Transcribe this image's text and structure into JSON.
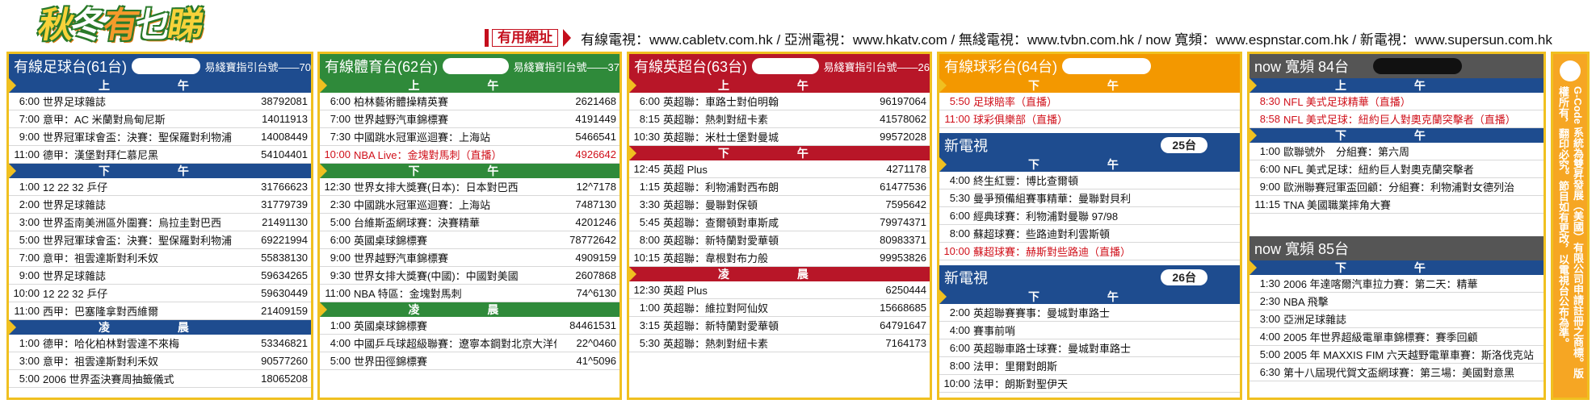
{
  "logo_text": [
    "秋",
    "冬",
    "有",
    "乜",
    "睇"
  ],
  "links": {
    "label": "有用網址",
    "text": "有線電視：www.cabletv.com.hk / 亞洲電視：www.hkatv.com / 無綫電視：www.tvbn.com.hk / now 寬頻：www.espnstar.com.hk / 新電視：www.supersun.com.hk"
  },
  "sections": {
    "am": "上 午",
    "pm": "下 午",
    "night": "凌 晨"
  },
  "panel1": {
    "title": "有線足球台(61台)",
    "guide": "易綫寶指引台號——70",
    "am": [
      {
        "t": "6:00",
        "p": "世界足球雜誌",
        "c": "38792081"
      },
      {
        "t": "7:00",
        "p": "意甲：AC 米蘭對烏甸尼斯",
        "c": "14011913"
      },
      {
        "t": "9:00",
        "p": "世界冠軍球會盃：決賽：聖保羅對利物浦",
        "c": "14008449"
      },
      {
        "t": "11:00",
        "p": "德甲：漢堡對拜仁慕尼黑",
        "c": "54104401"
      }
    ],
    "pm": [
      {
        "t": "1:00",
        "p": "12 22 32 乒仔",
        "c": "31766623"
      },
      {
        "t": "2:00",
        "p": "世界足球雜誌",
        "c": "31779739"
      },
      {
        "t": "3:00",
        "p": "世界盃南美洲區外圍賽：烏拉圭對巴西",
        "c": "21491130"
      },
      {
        "t": "5:00",
        "p": "世界冠軍球會盃：決賽：聖保羅對利物浦",
        "c": "69221994"
      },
      {
        "t": "7:00",
        "p": "意甲：祖雲達斯對利禾奴",
        "c": "55838130"
      },
      {
        "t": "9:00",
        "p": "世界足球雜誌",
        "c": "59634265"
      },
      {
        "t": "10:00",
        "p": "12 22 32 乒仔",
        "c": "59630449"
      },
      {
        "t": "11:00",
        "p": "西甲：巴塞隆拿對西維爾",
        "c": "21409159"
      }
    ],
    "night": [
      {
        "t": "1:00",
        "p": "德甲：哈化柏林對雲達不來梅",
        "c": "53346821"
      },
      {
        "t": "3:00",
        "p": "意甲：祖雲達斯對利禾奴",
        "c": "90577260"
      },
      {
        "t": "5:00",
        "p": "2006 世界盃決賽周抽籤儀式",
        "c": "18065208"
      }
    ]
  },
  "panel2": {
    "title": "有線體育台(62台)",
    "guide": "易綫寶指引台號——37",
    "am": [
      {
        "t": "6:00",
        "p": "柏林藝術體操精英賽",
        "c": "2621468"
      },
      {
        "t": "7:00",
        "p": "世界越野汽車錦標賽",
        "c": "4191449"
      },
      {
        "t": "7:30",
        "p": "中國跳水冠軍巡迴賽：上海站",
        "c": "5466541"
      },
      {
        "t": "10:00",
        "p": "NBA Live：金塊對馬刺（直播）",
        "c": "4926642",
        "live": true
      }
    ],
    "pm": [
      {
        "t": "12:30",
        "p": "世界女排大獎賽(日本)：日本對巴西",
        "c": "12^7178"
      },
      {
        "t": "2:30",
        "p": "中國跳水冠軍巡迴賽：上海站",
        "c": "7487130"
      },
      {
        "t": "5:00",
        "p": "台維斯盃網球賽：決賽精華",
        "c": "4201246"
      },
      {
        "t": "6:00",
        "p": "英國桌球錦標賽",
        "c": "78772642"
      },
      {
        "t": "9:00",
        "p": "世界越野汽車錦標賽",
        "c": "4909159"
      },
      {
        "t": "9:30",
        "p": "世界女排大獎賽(中國)：中國對美國",
        "c": "2607868"
      },
      {
        "t": "11:00",
        "p": "NBA 特區：金塊對馬刺",
        "c": "74^6130"
      }
    ],
    "night": [
      {
        "t": "1:00",
        "p": "英國桌球錦標賽",
        "c": "84461531"
      },
      {
        "t": "4:00",
        "p": "中國乒乓球超級聯賽：遼寧本鋼對北京大洋伐克",
        "c": "22^0460"
      },
      {
        "t": "5:00",
        "p": "世界田徑錦標賽",
        "c": "41^5096"
      }
    ]
  },
  "panel3": {
    "title": "有線英超台(63台)",
    "guide": "易綫寶指引台號——26",
    "am": [
      {
        "t": "6:00",
        "p": "英超聯：車路士對伯明翰",
        "c": "96197064"
      },
      {
        "t": "8:15",
        "p": "英超聯：熱刺對紐卡素",
        "c": "41578062"
      },
      {
        "t": "10:30",
        "p": "英超聯：米杜士堡對曼城",
        "c": "99572028"
      }
    ],
    "pm": [
      {
        "t": "12:45",
        "p": "英超 Plus",
        "c": "4271178"
      },
      {
        "t": "1:15",
        "p": "英超聯：利物浦對西布朗",
        "c": "61477536"
      },
      {
        "t": "3:30",
        "p": "英超聯：曼聯對保頓",
        "c": "7595642"
      },
      {
        "t": "5:45",
        "p": "英超聯：查爾頓對車斯咸",
        "c": "79974371"
      },
      {
        "t": "8:00",
        "p": "英超聯：新特蘭對愛華頓",
        "c": "80983371"
      },
      {
        "t": "10:15",
        "p": "英超聯：韋根對布力般",
        "c": "99953826"
      }
    ],
    "night": [
      {
        "t": "12:30",
        "p": "英超 Plus",
        "c": "6250444"
      },
      {
        "t": "1:00",
        "p": "英超聯：維拉對阿仙奴",
        "c": "15668685"
      },
      {
        "t": "3:15",
        "p": "英超聯：新特蘭對愛華頓",
        "c": "64791647"
      },
      {
        "t": "5:30",
        "p": "英超聯：熱刺對紐卡素",
        "c": "7164173"
      }
    ]
  },
  "panel4": {
    "title": "有線球彩台(64台)",
    "pm": [
      {
        "t": "5:50",
        "p": "足球賠率（直播）",
        "live": true
      },
      {
        "t": "11:00",
        "p": "球彩俱樂部（直播）",
        "live": true
      }
    ],
    "new25": {
      "title": "新電視",
      "badge": "25台",
      "rows": [
        {
          "t": "4:00",
          "p": "終生紅豐：博比查爾頓"
        },
        {
          "t": "5:30",
          "p": "曼爭預備組賽事精華：曼聯對貝利"
        },
        {
          "t": "6:00",
          "p": "經典球賽：利物浦對曼聯 97/98"
        },
        {
          "t": "8:00",
          "p": "蘇超球賽：些路迪對利雲斯頓"
        },
        {
          "t": "10:00",
          "p": "蘇超球賽：赫斯對些路迪（直播）",
          "live": true
        }
      ]
    },
    "new26": {
      "title": "新電視",
      "badge": "26台",
      "rows": [
        {
          "t": "2:00",
          "p": "英超聯賽賽事：曼城對車路士"
        },
        {
          "t": "4:00",
          "p": "賽事前哨"
        },
        {
          "t": "6:00",
          "p": "英超聯車路士球賽：曼城對車路士"
        },
        {
          "t": "8:00",
          "p": "法甲：里爾對朗斯"
        },
        {
          "t": "10:00",
          "p": "法甲：朗斯對聖伊天"
        }
      ]
    }
  },
  "panel5": {
    "title": "now 寬頻 84台",
    "am": [
      {
        "t": "8:30",
        "p": "NFL 美式足球精華（直播）",
        "live": true
      },
      {
        "t": "8:58",
        "p": "NFL 美式足球：紐約巨人對奧克蘭突擊者（直播）",
        "live": true
      }
    ],
    "pm": [
      {
        "t": "1:00",
        "p": "歐聯號外　分組賽：第六周"
      },
      {
        "t": "6:00",
        "p": "NFL 美式足球：紐約巨人對奧克蘭突擊者"
      },
      {
        "t": "9:00",
        "p": "歐洲聯賽冠軍盃回顧：分組賽：利物浦對女德列治"
      },
      {
        "t": "11:15",
        "p": "TNA 美國職業摔角大賽"
      }
    ],
    "sub": {
      "title": "now 寬頻 85台",
      "rows": [
        {
          "t": "1:30",
          "p": "2006 年達喀爾汽車拉力賽：第二天：精華"
        },
        {
          "t": "2:30",
          "p": "NBA 飛擊"
        },
        {
          "t": "3:00",
          "p": "亞洲足球雜誌"
        },
        {
          "t": "4:00",
          "p": "2005 年世界超級電單車錦標賽：賽季回顧"
        },
        {
          "t": "5:00",
          "p": "2005 年 MAXXIS FIM 六天越野電單車賽：斯洛伐克站"
        },
        {
          "t": "6:30",
          "p": "第十八屆現代賀文盃網球賽：第三場：美國對意黑"
        }
      ]
    }
  },
  "side_text": "G-Code 系統為雙昇發展（美國）有限公司申請註冊之商標。版權所有，翻印必究。節目如有更改，以電視台公布為準。",
  "colors": {
    "blue": "#1e4c8f",
    "green": "#2f8a3a",
    "red": "#b81628",
    "orange": "#f39800",
    "gray": "#555555",
    "yellow": "#f0c020"
  }
}
